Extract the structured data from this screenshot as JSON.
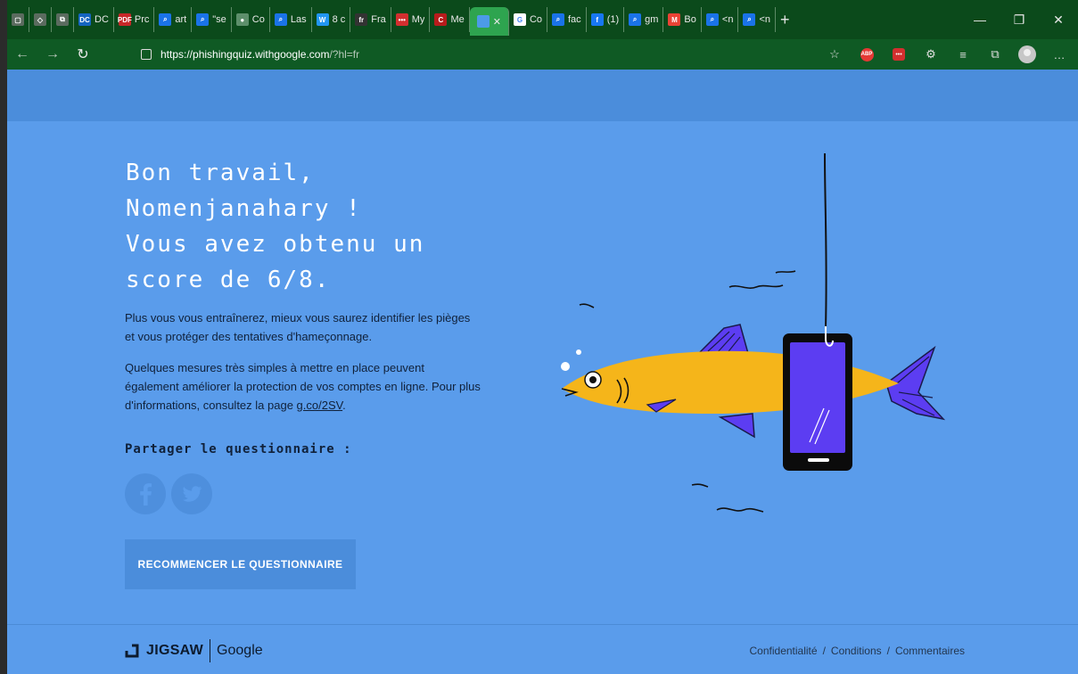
{
  "browser": {
    "tabs": [
      {
        "label": "",
        "icon": "window-icon",
        "color": "#5b6b5f"
      },
      {
        "label": "",
        "icon": "code-icon",
        "color": "#5b6b5f"
      },
      {
        "label": "",
        "icon": "copy-icon",
        "color": "#5b6b5f"
      },
      {
        "label": "DC",
        "icon": "dc-icon",
        "color": "#1565c0"
      },
      {
        "label": "Prc",
        "icon": "pdf-icon",
        "color": "#c62828"
      },
      {
        "label": "art",
        "icon": "search-icon",
        "color": "#1a73e8"
      },
      {
        "label": "\"se",
        "icon": "search-icon",
        "color": "#1a73e8"
      },
      {
        "label": "Co",
        "icon": "avatar-icon",
        "color": "#5d8f6b"
      },
      {
        "label": "Las",
        "icon": "search-icon",
        "color": "#1a73e8"
      },
      {
        "label": "8 c",
        "icon": "w-icon",
        "color": "#2196f3"
      },
      {
        "label": "Fra",
        "icon": "fr-icon",
        "color": "#333333"
      },
      {
        "label": "My",
        "icon": "lastpass-icon",
        "color": "#d32f2f"
      },
      {
        "label": "Me",
        "icon": "c-icon",
        "color": "#b71c1c"
      },
      {
        "label": "",
        "icon": "page-icon",
        "color": "#4c9be8",
        "active": true
      },
      {
        "label": "Co",
        "icon": "google-icon",
        "color": "#ffffff"
      },
      {
        "label": "fac",
        "icon": "search-icon",
        "color": "#1a73e8"
      },
      {
        "label": "(1)",
        "icon": "facebook-icon",
        "color": "#1877f2"
      },
      {
        "label": "gm",
        "icon": "search-icon",
        "color": "#1a73e8"
      },
      {
        "label": "Bo",
        "icon": "gmail-icon",
        "color": "#ea4335"
      },
      {
        "label": "<n",
        "icon": "search-icon",
        "color": "#1a73e8"
      },
      {
        "label": "<n",
        "icon": "search-icon",
        "color": "#1a73e8"
      }
    ],
    "url_host": "https://phishingquiz.withgoogle.com",
    "url_rest": "/?hl=fr"
  },
  "quiz": {
    "headline": [
      "Bon travail,",
      "Nomenjanahary !",
      "Vous avez obtenu un",
      "score de 6/8."
    ],
    "para1": "Plus vous vous entraînerez, mieux vous saurez identifier les pièges et vous protéger des tentatives d'hameçonnage.",
    "para2_text": "Quelques mesures très simples à mettre en place peuvent également améliorer la protection de vos comptes en ligne. Pour plus d'informations, consultez la page ",
    "para2_link": "g.co/2SV",
    "para2_end": ".",
    "share_label": "Partager le questionnaire :",
    "restart_label": "RECOMMENCER LE QUESTIONNAIRE"
  },
  "footer": {
    "jigsaw": "JIGSAW",
    "google": "Google",
    "links": [
      "Confidentialité",
      "Conditions",
      "Commentaires"
    ],
    "separator": "/"
  },
  "colors": {
    "page_bg": "#5a9ceb",
    "header_band": "#4b8ddb",
    "fish_yellow": "#f5b51a",
    "phone_screen": "#5c3df2",
    "browser_green": "#0b4a1b"
  }
}
